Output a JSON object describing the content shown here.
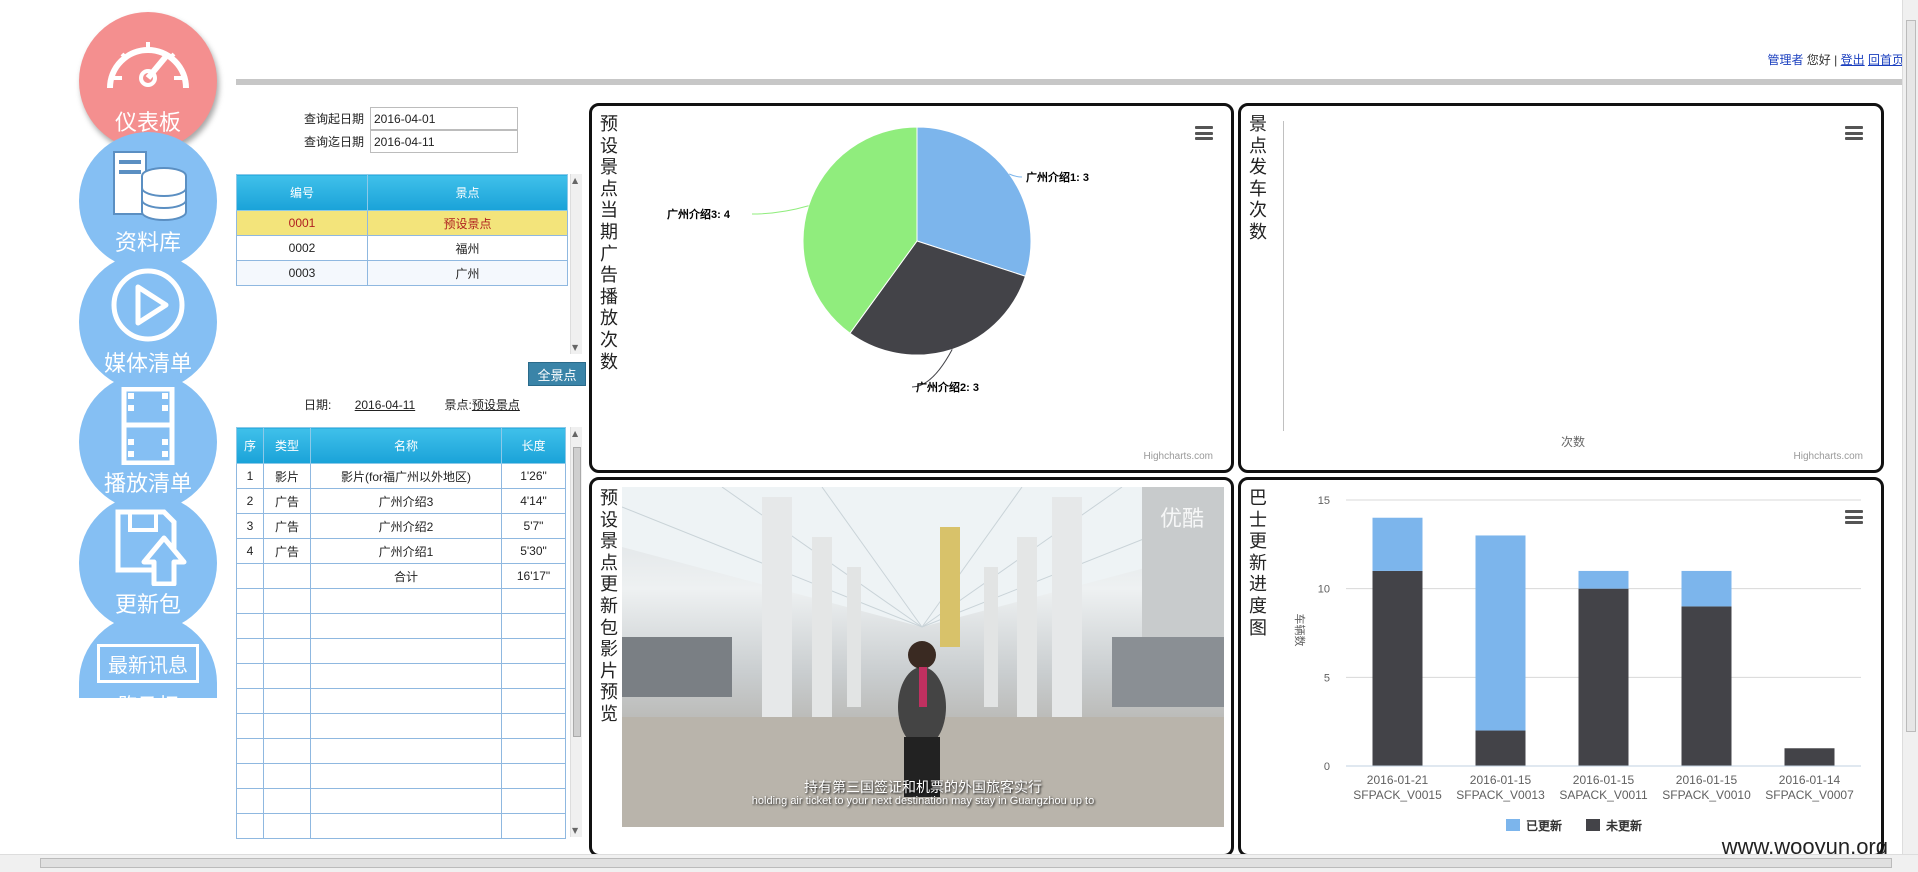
{
  "nav": [
    {
      "label": "仪表板",
      "icon": "speedometer-icon"
    },
    {
      "label": "资料库",
      "icon": "database-icon"
    },
    {
      "label": "媒体清单",
      "icon": "play-icon"
    },
    {
      "label": "播放清单",
      "icon": "film-icon"
    },
    {
      "label": "更新包",
      "icon": "save-upload-icon"
    },
    {
      "label": "最新讯息",
      "sub": "跑马灯",
      "icon": "news-icon"
    }
  ],
  "userbar": {
    "role": "管理者",
    "greeting": "您好",
    "sep": "|",
    "logout": "登出",
    "home": "回首页"
  },
  "query": {
    "start_label": "查询起日期",
    "start_value": "2016-04-01",
    "end_label": "查询迄日期",
    "end_value": "2016-04-11"
  },
  "spots_table": {
    "headers": [
      "编号",
      "景点"
    ],
    "rows": [
      [
        "0001",
        "预设景点"
      ],
      [
        "0002",
        "福州"
      ],
      [
        "0003",
        "广州"
      ]
    ]
  },
  "all_spots_button": "全景点",
  "date_info": {
    "date_label": "日期:",
    "date_value": "2016-04-11",
    "spot_label": "景点:",
    "spot_value": "预设景点"
  },
  "media_table": {
    "headers": [
      "序",
      "类型",
      "名称",
      "长度"
    ],
    "rows": [
      [
        "1",
        "影片",
        "影片(for福广州以外地区)",
        "1'26\""
      ],
      [
        "2",
        "广告",
        "广州介绍3",
        "4'14\""
      ],
      [
        "3",
        "广告",
        "广州介绍2",
        "5'7\""
      ],
      [
        "4",
        "广告",
        "广州介绍1",
        "5'30\""
      ]
    ],
    "total_label": "合计",
    "total_value": "16'17\""
  },
  "panels": {
    "pie_title": "预设景点当期广告播放次数",
    "trips_title": "景点发车次数",
    "trips_xlabel": "次数",
    "video_title": "预设景点更新包影片预览",
    "bus_title": "巴士更新进度图",
    "credit": "Highcharts.com"
  },
  "video": {
    "watermark": "优酷",
    "subtitle_cn": "持有第三国签证和机票的外国旅客实行",
    "subtitle_en": "holding air ticket to your next destination may stay in Guangzhou up to"
  },
  "page_watermark": "www.wooyun.org",
  "colors": {
    "blue": "#7cb5ec",
    "dark": "#434348",
    "green": "#90ed7d",
    "nav_blue": "#85bff3",
    "nav_active": "#f48f8f"
  },
  "chart_data": [
    {
      "type": "pie",
      "title": "预设景点当期广告播放次数",
      "series": [
        {
          "values": [
            {
              "name": "广州介绍1",
              "y": 3
            },
            {
              "name": "广州介绍2",
              "y": 3
            },
            {
              "name": "广州介绍3",
              "y": 4
            }
          ]
        }
      ]
    },
    {
      "type": "bar",
      "title": "巴士更新进度图",
      "ylabel": "车辆数",
      "ylim": [
        0,
        15
      ],
      "yticks": [
        0,
        5,
        10,
        15
      ],
      "categories": [
        [
          "2016-01-21",
          "SFPACK_V0015"
        ],
        [
          "2016-01-15",
          "SFPACK_V0013"
        ],
        [
          "2016-01-15",
          "SAPACK_V0011"
        ],
        [
          "2016-01-15",
          "SFPACK_V0010"
        ],
        [
          "2016-01-14",
          "SFPACK_V0007"
        ]
      ],
      "series": [
        {
          "name": "已更新",
          "values": [
            3,
            11,
            1,
            2,
            0
          ]
        },
        {
          "name": "未更新",
          "values": [
            11,
            2,
            10,
            9,
            1
          ]
        }
      ],
      "stacked": true,
      "legend": "bottom-center"
    }
  ]
}
